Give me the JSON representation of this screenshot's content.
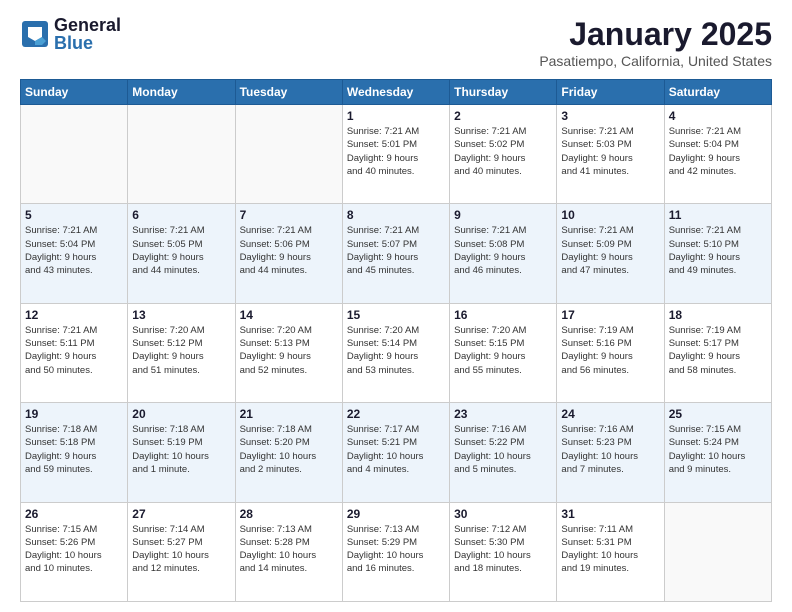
{
  "logo": {
    "general": "General",
    "blue": "Blue"
  },
  "header": {
    "month": "January 2025",
    "location": "Pasatiempo, California, United States"
  },
  "weekdays": [
    "Sunday",
    "Monday",
    "Tuesday",
    "Wednesday",
    "Thursday",
    "Friday",
    "Saturday"
  ],
  "weeks": [
    {
      "days": [
        {
          "date": "",
          "info": ""
        },
        {
          "date": "",
          "info": ""
        },
        {
          "date": "",
          "info": ""
        },
        {
          "date": "1",
          "info": "Sunrise: 7:21 AM\nSunset: 5:01 PM\nDaylight: 9 hours\nand 40 minutes."
        },
        {
          "date": "2",
          "info": "Sunrise: 7:21 AM\nSunset: 5:02 PM\nDaylight: 9 hours\nand 40 minutes."
        },
        {
          "date": "3",
          "info": "Sunrise: 7:21 AM\nSunset: 5:03 PM\nDaylight: 9 hours\nand 41 minutes."
        },
        {
          "date": "4",
          "info": "Sunrise: 7:21 AM\nSunset: 5:04 PM\nDaylight: 9 hours\nand 42 minutes."
        }
      ]
    },
    {
      "days": [
        {
          "date": "5",
          "info": "Sunrise: 7:21 AM\nSunset: 5:04 PM\nDaylight: 9 hours\nand 43 minutes."
        },
        {
          "date": "6",
          "info": "Sunrise: 7:21 AM\nSunset: 5:05 PM\nDaylight: 9 hours\nand 44 minutes."
        },
        {
          "date": "7",
          "info": "Sunrise: 7:21 AM\nSunset: 5:06 PM\nDaylight: 9 hours\nand 44 minutes."
        },
        {
          "date": "8",
          "info": "Sunrise: 7:21 AM\nSunset: 5:07 PM\nDaylight: 9 hours\nand 45 minutes."
        },
        {
          "date": "9",
          "info": "Sunrise: 7:21 AM\nSunset: 5:08 PM\nDaylight: 9 hours\nand 46 minutes."
        },
        {
          "date": "10",
          "info": "Sunrise: 7:21 AM\nSunset: 5:09 PM\nDaylight: 9 hours\nand 47 minutes."
        },
        {
          "date": "11",
          "info": "Sunrise: 7:21 AM\nSunset: 5:10 PM\nDaylight: 9 hours\nand 49 minutes."
        }
      ]
    },
    {
      "days": [
        {
          "date": "12",
          "info": "Sunrise: 7:21 AM\nSunset: 5:11 PM\nDaylight: 9 hours\nand 50 minutes."
        },
        {
          "date": "13",
          "info": "Sunrise: 7:20 AM\nSunset: 5:12 PM\nDaylight: 9 hours\nand 51 minutes."
        },
        {
          "date": "14",
          "info": "Sunrise: 7:20 AM\nSunset: 5:13 PM\nDaylight: 9 hours\nand 52 minutes."
        },
        {
          "date": "15",
          "info": "Sunrise: 7:20 AM\nSunset: 5:14 PM\nDaylight: 9 hours\nand 53 minutes."
        },
        {
          "date": "16",
          "info": "Sunrise: 7:20 AM\nSunset: 5:15 PM\nDaylight: 9 hours\nand 55 minutes."
        },
        {
          "date": "17",
          "info": "Sunrise: 7:19 AM\nSunset: 5:16 PM\nDaylight: 9 hours\nand 56 minutes."
        },
        {
          "date": "18",
          "info": "Sunrise: 7:19 AM\nSunset: 5:17 PM\nDaylight: 9 hours\nand 58 minutes."
        }
      ]
    },
    {
      "days": [
        {
          "date": "19",
          "info": "Sunrise: 7:18 AM\nSunset: 5:18 PM\nDaylight: 9 hours\nand 59 minutes."
        },
        {
          "date": "20",
          "info": "Sunrise: 7:18 AM\nSunset: 5:19 PM\nDaylight: 10 hours\nand 1 minute."
        },
        {
          "date": "21",
          "info": "Sunrise: 7:18 AM\nSunset: 5:20 PM\nDaylight: 10 hours\nand 2 minutes."
        },
        {
          "date": "22",
          "info": "Sunrise: 7:17 AM\nSunset: 5:21 PM\nDaylight: 10 hours\nand 4 minutes."
        },
        {
          "date": "23",
          "info": "Sunrise: 7:16 AM\nSunset: 5:22 PM\nDaylight: 10 hours\nand 5 minutes."
        },
        {
          "date": "24",
          "info": "Sunrise: 7:16 AM\nSunset: 5:23 PM\nDaylight: 10 hours\nand 7 minutes."
        },
        {
          "date": "25",
          "info": "Sunrise: 7:15 AM\nSunset: 5:24 PM\nDaylight: 10 hours\nand 9 minutes."
        }
      ]
    },
    {
      "days": [
        {
          "date": "26",
          "info": "Sunrise: 7:15 AM\nSunset: 5:26 PM\nDaylight: 10 hours\nand 10 minutes."
        },
        {
          "date": "27",
          "info": "Sunrise: 7:14 AM\nSunset: 5:27 PM\nDaylight: 10 hours\nand 12 minutes."
        },
        {
          "date": "28",
          "info": "Sunrise: 7:13 AM\nSunset: 5:28 PM\nDaylight: 10 hours\nand 14 minutes."
        },
        {
          "date": "29",
          "info": "Sunrise: 7:13 AM\nSunset: 5:29 PM\nDaylight: 10 hours\nand 16 minutes."
        },
        {
          "date": "30",
          "info": "Sunrise: 7:12 AM\nSunset: 5:30 PM\nDaylight: 10 hours\nand 18 minutes."
        },
        {
          "date": "31",
          "info": "Sunrise: 7:11 AM\nSunset: 5:31 PM\nDaylight: 10 hours\nand 19 minutes."
        },
        {
          "date": "",
          "info": ""
        }
      ]
    }
  ]
}
